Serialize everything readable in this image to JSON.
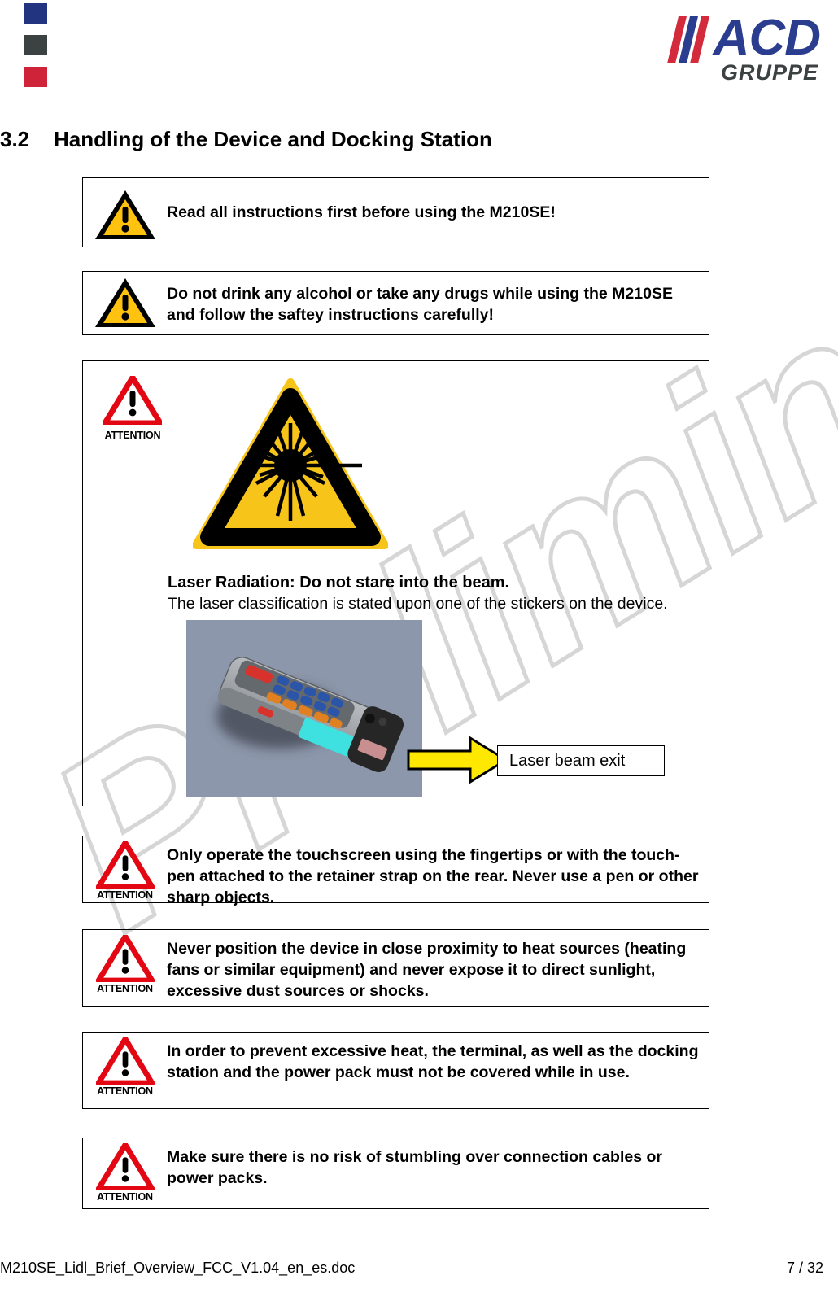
{
  "header": {
    "squares": [
      {
        "name": "blue",
        "color": "#223380"
      },
      {
        "name": "gray",
        "color": "#3c4242"
      },
      {
        "name": "red",
        "color": "#ce2339"
      }
    ],
    "logo": {
      "brand": "ACD",
      "subtitle": "GRUPPE",
      "slash_red": "#d32b3c",
      "slash_blue": "#2b3d8f",
      "brand_color": "#2b3d8f",
      "subtitle_color": "#3c4242"
    }
  },
  "watermark": {
    "text": "Preliminary",
    "color": "#d6d6d6"
  },
  "section": {
    "number": "3.2",
    "title": "Handling of the Device and Docking Station"
  },
  "warnings": [
    {
      "id": "read",
      "icon": "warning-triangle-yellow-icon",
      "icon_label": "",
      "text": "Read all instructions first before using the M210SE!"
    },
    {
      "id": "alcohol",
      "icon": "warning-triangle-yellow-icon",
      "icon_label": "",
      "text": "Do not drink any alcohol or take any drugs while using the M210SE and follow the saftey instructions carefully!"
    },
    {
      "id": "touch",
      "icon": "attention-triangle-red-icon",
      "icon_label": "ATTENTION",
      "text": "Only operate the touchscreen using the fingertips or with the touch-pen attached to the retainer strap on the rear. Never use a pen or other sharp objects."
    },
    {
      "id": "heat",
      "icon": "attention-triangle-red-icon",
      "icon_label": "ATTENTION",
      "text": "Never position the device in close proximity to heat sources (heating fans or similar equipment) and never expose it to direct sunlight, excessive dust sources or shocks."
    },
    {
      "id": "cover",
      "icon": "attention-triangle-red-icon",
      "icon_label": "ATTENTION",
      "text": "In order to prevent excessive heat, the terminal, as well as the docking station and the power pack must not be covered while in use."
    },
    {
      "id": "stumble",
      "icon": "attention-triangle-red-icon",
      "icon_label": "ATTENTION",
      "text": "Make sure there is no risk of stumbling over connection cables or power packs."
    }
  ],
  "laser_panel": {
    "attention_label": "ATTENTION",
    "sign_icon": "laser-radiation-warning-icon",
    "sign_colors": {
      "fill": "#f7c41a",
      "border": "#000000"
    },
    "caption_bold": "Laser Radiation: Do not stare into the beam.",
    "caption_normal": "The laser classification is stated upon one of the stickers on the device.",
    "photo_alt": "3D rendering of M210SE handheld terminal",
    "photo_colors": {
      "background": "#8d97ab",
      "body": "#a0a3a6",
      "keys_blue": "#2b55a8",
      "keys_orange": "#e08020",
      "keys_red": "#d8322c",
      "screen": "#3fe0e0",
      "head": "#262626"
    },
    "callout_label": "Laser beam exit",
    "callout_arrow_color": "#ffe800"
  },
  "footer": {
    "filename": "M210SE_Lidl_Brief_Overview_FCC_V1.04_en_es.doc",
    "page": "7 / 32"
  }
}
